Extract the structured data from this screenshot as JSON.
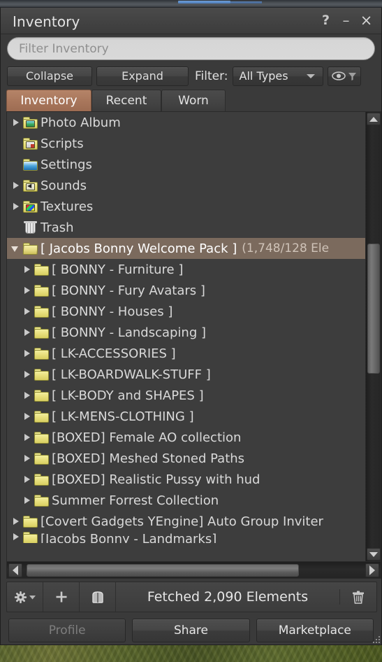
{
  "window": {
    "title": "Inventory",
    "help_label": "?",
    "minimize_label": "–",
    "close_label": "×"
  },
  "search": {
    "placeholder": "Filter Inventory",
    "value": ""
  },
  "toolbar": {
    "collapse_label": "Collapse",
    "expand_label": "Expand",
    "filter_label": "Filter:",
    "filter_value": "All Types",
    "filter_options": [
      "All Types"
    ],
    "visibility_icon": "eye-icon"
  },
  "tabs": [
    {
      "label": "Inventory",
      "active": true
    },
    {
      "label": "Recent",
      "active": false
    },
    {
      "label": "Worn",
      "active": false
    }
  ],
  "tree": [
    {
      "label": "Photo Album",
      "indent": 0,
      "arrow": "closed",
      "icon": "folder-photo-icon",
      "selected": false
    },
    {
      "label": "Scripts",
      "indent": 0,
      "arrow": "none",
      "icon": "folder-script-icon",
      "selected": false
    },
    {
      "label": "Settings",
      "indent": 0,
      "arrow": "none",
      "icon": "folder-settings-icon",
      "selected": false
    },
    {
      "label": "Sounds",
      "indent": 0,
      "arrow": "closed",
      "icon": "folder-sound-icon",
      "selected": false
    },
    {
      "label": "Textures",
      "indent": 0,
      "arrow": "closed",
      "icon": "folder-texture-icon",
      "selected": false
    },
    {
      "label": "Trash",
      "indent": 0,
      "arrow": "none",
      "icon": "trash-icon",
      "selected": false
    },
    {
      "label": "[ Jacobs Bonny Welcome Pack ]",
      "count": "(1,748/128 Ele",
      "indent": 0,
      "arrow": "open",
      "icon": "folder-open-icon",
      "selected": true
    },
    {
      "label": "[ BONNY - Furniture ]",
      "indent": 1,
      "arrow": "closed",
      "icon": "folder-icon",
      "selected": false
    },
    {
      "label": "[ BONNY - Fury Avatars ]",
      "indent": 1,
      "arrow": "closed",
      "icon": "folder-icon",
      "selected": false
    },
    {
      "label": "[ BONNY - Houses ]",
      "indent": 1,
      "arrow": "closed",
      "icon": "folder-icon",
      "selected": false
    },
    {
      "label": "[ BONNY - Landscaping ]",
      "indent": 1,
      "arrow": "closed",
      "icon": "folder-icon",
      "selected": false
    },
    {
      "label": "[ LK-ACCESSORIES ]",
      "indent": 1,
      "arrow": "closed",
      "icon": "folder-icon",
      "selected": false
    },
    {
      "label": "[ LK-BOARDWALK-STUFF ]",
      "indent": 1,
      "arrow": "closed",
      "icon": "folder-icon",
      "selected": false
    },
    {
      "label": "[ LK-BODY and SHAPES ]",
      "indent": 1,
      "arrow": "closed",
      "icon": "folder-icon",
      "selected": false
    },
    {
      "label": "[ LK-MENS-CLOTHING ]",
      "indent": 1,
      "arrow": "closed",
      "icon": "folder-icon",
      "selected": false
    },
    {
      "label": "[BOXED] Female AO collection",
      "indent": 1,
      "arrow": "closed",
      "icon": "folder-icon",
      "selected": false
    },
    {
      "label": "[BOXED] Meshed Stoned Paths",
      "indent": 1,
      "arrow": "closed",
      "icon": "folder-icon",
      "selected": false
    },
    {
      "label": "[BOXED] Realistic Pussy with hud",
      "indent": 1,
      "arrow": "closed",
      "icon": "folder-icon",
      "selected": false
    },
    {
      "label": "Summer Forrest Collection",
      "indent": 1,
      "arrow": "closed",
      "icon": "folder-icon",
      "selected": false
    },
    {
      "label": "[Covert Gadgets YEngine] Auto Group Inviter",
      "indent": 0,
      "arrow": "closed",
      "icon": "folder-icon",
      "selected": false
    },
    {
      "label": "[Jacobs Bonny - Landmarks]",
      "indent": 0,
      "arrow": "closed",
      "icon": "folder-icon",
      "selected": false,
      "clipped": true
    }
  ],
  "status": {
    "text": "Fetched 2,090 Elements",
    "gear_icon": "gear-icon",
    "add_icon": "plus-icon",
    "wardrobe_icon": "wardrobe-icon",
    "trash_icon": "trash-icon"
  },
  "actions": [
    {
      "label": "Profile",
      "disabled": true
    },
    {
      "label": "Share",
      "disabled": false
    },
    {
      "label": "Marketplace",
      "disabled": false
    }
  ],
  "colors": {
    "selected_tab": "#a8765b",
    "selected_row": "#7b6a5d",
    "window_bg": "#3a3a3a",
    "list_bg": "#3d3d3d",
    "text": "#d9d9d9"
  }
}
